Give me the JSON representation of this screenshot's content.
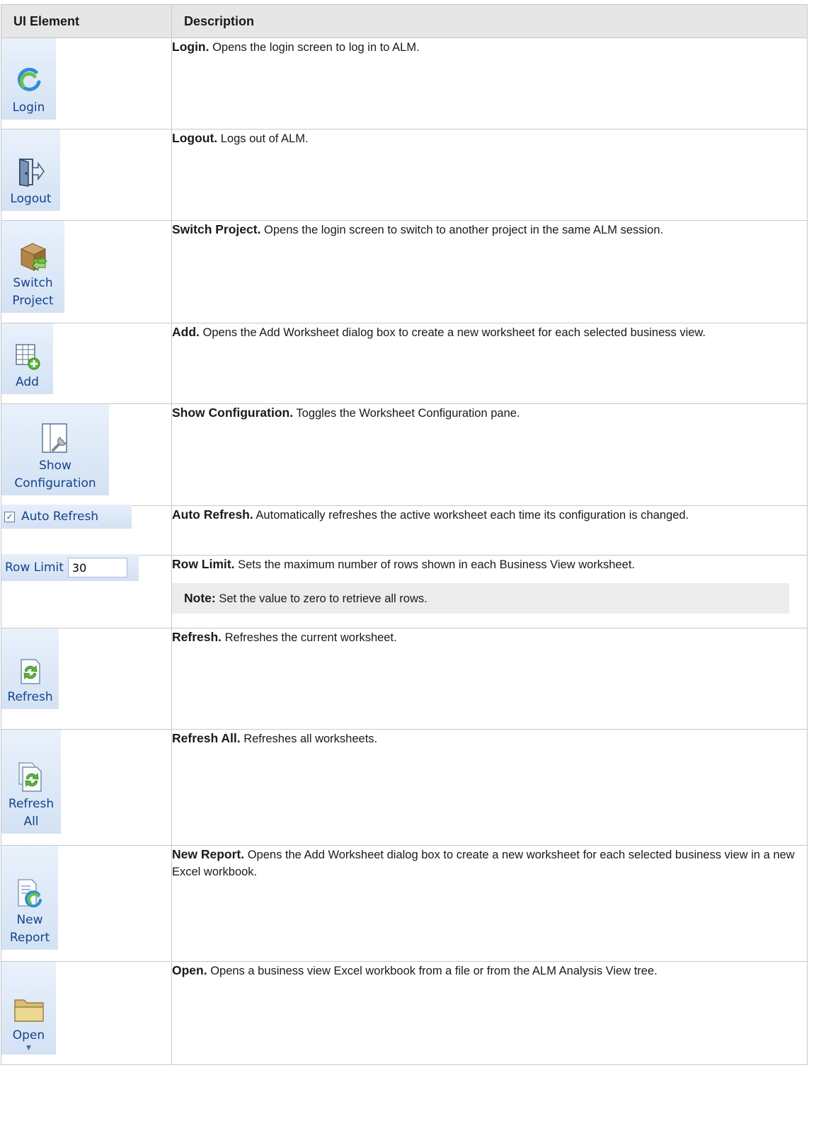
{
  "table": {
    "headers": [
      "UI Element",
      "Description"
    ],
    "rows": [
      {
        "label": "Login",
        "term": "Login.",
        "desc": "Opens the login screen to log in to ALM.",
        "icon": "login-icon"
      },
      {
        "label": "Logout",
        "term": "Logout.",
        "desc": "Logs out of ALM.",
        "icon": "logout-icon"
      },
      {
        "label": "Switch Project",
        "label_line1": "Switch",
        "label_line2": "Project",
        "term": "Switch Project.",
        "desc": "Opens the login screen to switch to another project in the same ALM session.",
        "icon": "switch-project-icon"
      },
      {
        "label": "Add",
        "term": "Add.",
        "desc": "Opens the Add Worksheet dialog box to create a new worksheet for each selected business view.",
        "icon": "add-worksheet-icon"
      },
      {
        "label": "Show Configuration",
        "label_line1": "Show",
        "label_line2": "Configuration",
        "term": "Show Configuration.",
        "desc": "Toggles the Worksheet Configuration pane.",
        "icon": "show-configuration-icon"
      },
      {
        "label": "Auto Refresh",
        "term": "Auto Refresh.",
        "desc": "Automatically refreshes the active worksheet each time its configuration is changed.",
        "checked": true
      },
      {
        "label": "Row Limit",
        "value": "30",
        "term": "Row Limit.",
        "desc": "Sets the maximum number of rows shown in each Business View worksheet.",
        "note_term": "Note:",
        "note_text": "Set the value to zero to retrieve all rows."
      },
      {
        "label": "Refresh",
        "term": "Refresh.",
        "desc": "Refreshes the current worksheet.",
        "icon": "refresh-icon"
      },
      {
        "label": "Refresh All",
        "label_line1": "Refresh",
        "label_line2": "All",
        "term": "Refresh All.",
        "desc": "Refreshes all worksheets.",
        "icon": "refresh-all-icon"
      },
      {
        "label": "New Report",
        "label_line1": "New",
        "label_line2": "Report",
        "term": "New Report.",
        "desc": "Opens the Add Worksheet dialog box to create a new worksheet for each selected business view in a new Excel workbook.",
        "icon": "new-report-icon"
      },
      {
        "label": "Open",
        "term": "Open.",
        "desc": "Opens a business view Excel workbook from a file or from the ALM Analysis View tree.",
        "icon": "open-folder-icon"
      }
    ]
  },
  "colors": {
    "header_bg": "#e6e6e6",
    "border": "#c8c8c8",
    "ribbon_text": "#15428b",
    "note_bg": "#ececec"
  }
}
